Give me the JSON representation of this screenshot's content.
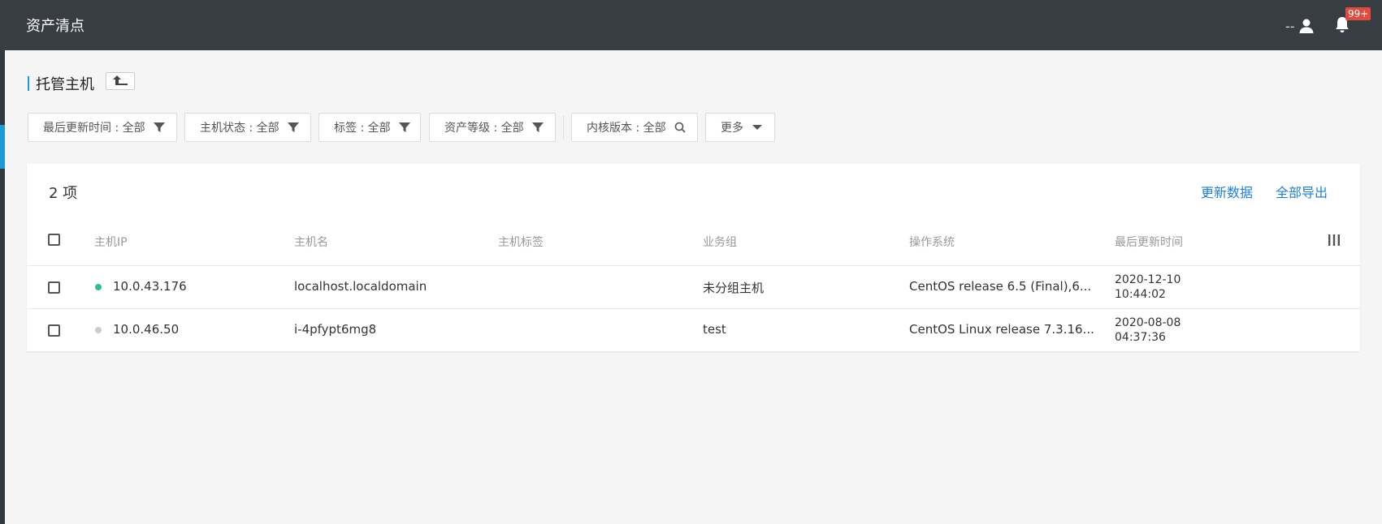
{
  "topbar": {
    "title": "资产清点",
    "user_name": "--",
    "notification_badge": "99+"
  },
  "page": {
    "title": "托管主机"
  },
  "filters": [
    {
      "label": "最后更新时间 : 全部",
      "icon": "filter-icon"
    },
    {
      "label": "主机状态 : 全部",
      "icon": "filter-icon"
    },
    {
      "label": "标签 : 全部",
      "icon": "filter-icon"
    },
    {
      "label": "资产等级 : 全部",
      "icon": "filter-icon"
    },
    {
      "label": "内核版本 : 全部",
      "icon": "search-icon"
    },
    {
      "label": "更多",
      "icon": "caret-down-icon"
    }
  ],
  "table": {
    "count_label": "2 项",
    "actions": {
      "refresh": "更新数据",
      "export_all": "全部导出"
    },
    "columns": [
      "主机IP",
      "主机名",
      "主机标签",
      "业务组",
      "操作系统",
      "最后更新时间"
    ],
    "rows": [
      {
        "ip": "10.0.43.176",
        "status_color": "#2dbf8f",
        "hostname": "localhost.localdomain",
        "tags": "",
        "group": "未分组主机",
        "os": "CentOS release 6.5 (Final),6...",
        "updated_date": "2020-12-10",
        "updated_time": "10:44:02"
      },
      {
        "ip": "10.0.46.50",
        "status_color": "#cccccc",
        "hostname": "i-4pfypt6mg8",
        "tags": "",
        "group": "test",
        "os": "CentOS Linux release 7.3.16...",
        "updated_date": "2020-08-08",
        "updated_time": "04:37:36"
      }
    ]
  },
  "colors": {
    "topbar_bg": "#383d44",
    "accent": "#1e9bd7",
    "link": "#1e7fd7",
    "badge": "#e04a3f"
  }
}
